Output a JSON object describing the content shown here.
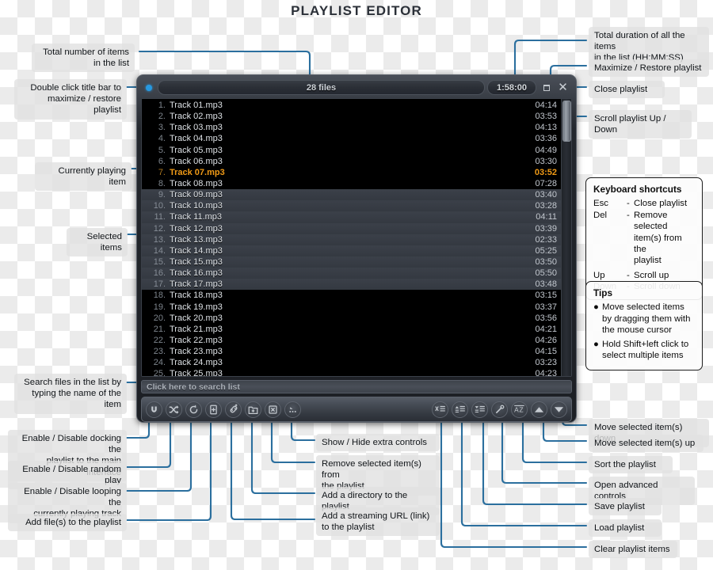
{
  "page": {
    "title": "PLAYLIST EDITOR"
  },
  "titlebar": {
    "file_count": "28 files",
    "duration": "1:58:00",
    "maximize_icon": "maximize-restore-icon",
    "close_icon": "close-icon",
    "status_dot": "status-dot-icon"
  },
  "playlist": {
    "tracks": [
      {
        "num": "1.",
        "name": "Track 01.mp3",
        "time": "04:14",
        "state": "normal"
      },
      {
        "num": "2.",
        "name": "Track 02.mp3",
        "time": "03:53",
        "state": "normal"
      },
      {
        "num": "3.",
        "name": "Track 03.mp3",
        "time": "04:13",
        "state": "normal"
      },
      {
        "num": "4.",
        "name": "Track 04.mp3",
        "time": "03:36",
        "state": "normal"
      },
      {
        "num": "5.",
        "name": "Track 05.mp3",
        "time": "04:49",
        "state": "normal"
      },
      {
        "num": "6.",
        "name": "Track 06.mp3",
        "time": "03:30",
        "state": "normal"
      },
      {
        "num": "7.",
        "name": "Track 07.mp3",
        "time": "03:52",
        "state": "playing"
      },
      {
        "num": "8.",
        "name": "Track 08.mp3",
        "time": "07:28",
        "state": "normal"
      },
      {
        "num": "9.",
        "name": "Track 09.mp3",
        "time": "03:40",
        "state": "selected"
      },
      {
        "num": "10.",
        "name": "Track 10.mp3",
        "time": "03:28",
        "state": "selected"
      },
      {
        "num": "11.",
        "name": "Track 11.mp3",
        "time": "04:11",
        "state": "selected"
      },
      {
        "num": "12.",
        "name": "Track 12.mp3",
        "time": "03:39",
        "state": "selected"
      },
      {
        "num": "13.",
        "name": "Track 13.mp3",
        "time": "02:33",
        "state": "selected"
      },
      {
        "num": "14.",
        "name": "Track 14.mp3",
        "time": "05:25",
        "state": "selected"
      },
      {
        "num": "15.",
        "name": "Track 15.mp3",
        "time": "03:50",
        "state": "selected"
      },
      {
        "num": "16.",
        "name": "Track 16.mp3",
        "time": "05:50",
        "state": "selected"
      },
      {
        "num": "17.",
        "name": "Track 17.mp3",
        "time": "03:48",
        "state": "selected"
      },
      {
        "num": "18.",
        "name": "Track 18.mp3",
        "time": "03:15",
        "state": "normal"
      },
      {
        "num": "19.",
        "name": "Track 19.mp3",
        "time": "03:37",
        "state": "normal"
      },
      {
        "num": "20.",
        "name": "Track 20.mp3",
        "time": "03:56",
        "state": "normal"
      },
      {
        "num": "21.",
        "name": "Track 21.mp3",
        "time": "04:21",
        "state": "normal"
      },
      {
        "num": "22.",
        "name": "Track 22.mp3",
        "time": "04:26",
        "state": "normal"
      },
      {
        "num": "23.",
        "name": "Track 23.mp3",
        "time": "04:15",
        "state": "normal"
      },
      {
        "num": "24.",
        "name": "Track 24.mp3",
        "time": "03:23",
        "state": "normal"
      },
      {
        "num": "25.",
        "name": "Track 25.mp3",
        "time": "04:23",
        "state": "normal"
      }
    ]
  },
  "search": {
    "placeholder": "Click here to search list",
    "value": ""
  },
  "toolbar": {
    "left_buttons": [
      {
        "icon": "magnet-dock-icon",
        "name": "dock-playlist-button"
      },
      {
        "icon": "shuffle-icon",
        "name": "random-play-button"
      },
      {
        "icon": "loop-icon",
        "name": "loop-track-button"
      },
      {
        "icon": "add-file-icon",
        "name": "add-file-button"
      },
      {
        "icon": "add-link-icon",
        "name": "add-url-button"
      },
      {
        "icon": "add-folder-icon",
        "name": "add-directory-button"
      },
      {
        "icon": "remove-item-icon",
        "name": "remove-item-button"
      },
      {
        "icon": "extra-controls-icon",
        "name": "extra-controls-button"
      }
    ],
    "right_buttons": [
      {
        "icon": "clear-list-icon",
        "name": "clear-playlist-button"
      },
      {
        "icon": "load-playlist-icon",
        "name": "load-playlist-button"
      },
      {
        "icon": "save-playlist-icon",
        "name": "save-playlist-button"
      },
      {
        "icon": "wand-icon",
        "name": "advanced-controls-button"
      },
      {
        "icon": "sort-az-icon",
        "name": "sort-playlist-button"
      },
      {
        "icon": "move-up-icon",
        "name": "move-up-button"
      },
      {
        "icon": "move-down-icon",
        "name": "move-down-button"
      }
    ]
  },
  "annotations": {
    "total_items": "Total number of items\nin the list",
    "double_click": "Double click title bar to\nmaximize / restore playlist",
    "currently_playing": "Currently playing item",
    "selected_items": "Selected items",
    "search_files": "Search files in the list by\ntyping the name of the item",
    "enable_docking": "Enable / Disable docking the\nplaylist to the main interface",
    "random_play": "Enable / Disable random play",
    "looping": "Enable / Disable looping the\ncurrently playing track",
    "add_files": "Add file(s) to the playlist",
    "show_hide_extra": "Show / Hide extra controls",
    "remove_selected": "Remove selected item(s) from\nthe playlist",
    "add_directory": "Add a directory to the playlist",
    "add_streaming": "Add a streaming URL (link)\nto the playlist",
    "total_duration": "Total duration of all the items\nin the list (HH:MM:SS)",
    "maximize_restore": "Maximize / Restore playlist",
    "close_playlist": "Close playlist",
    "scroll_playlist": "Scroll playlist Up / Down",
    "move_down": "Move selected item(s) down",
    "move_up": "Move selected item(s) up",
    "sort_playlist": "Sort the playlist",
    "advanced_controls": "Open advanced controls",
    "save_playlist": "Save playlist",
    "load_playlist": "Load playlist",
    "clear_playlist": "Clear playlist items"
  },
  "keyboard_shortcuts": {
    "title": "Keyboard shortcuts",
    "rows": [
      {
        "key": "Esc",
        "dash": "-",
        "desc": "Close playlist"
      },
      {
        "key": "Del",
        "dash": "-",
        "desc": "Remove selected\nitem(s) from the\nplaylist"
      },
      {
        "key": "Up",
        "dash": "-",
        "desc": "Scroll up"
      },
      {
        "key": "Down",
        "dash": "-",
        "desc": "Scroll down"
      }
    ]
  },
  "tips": {
    "title": "Tips",
    "items": [
      "Move selected items by dragging them with the mouse cursor",
      "Hold Shift+left click to select multiple items"
    ]
  },
  "colors": {
    "connector": "#2b6f9e",
    "playing": "#f09a16",
    "accent_dot": "#2798e0"
  }
}
